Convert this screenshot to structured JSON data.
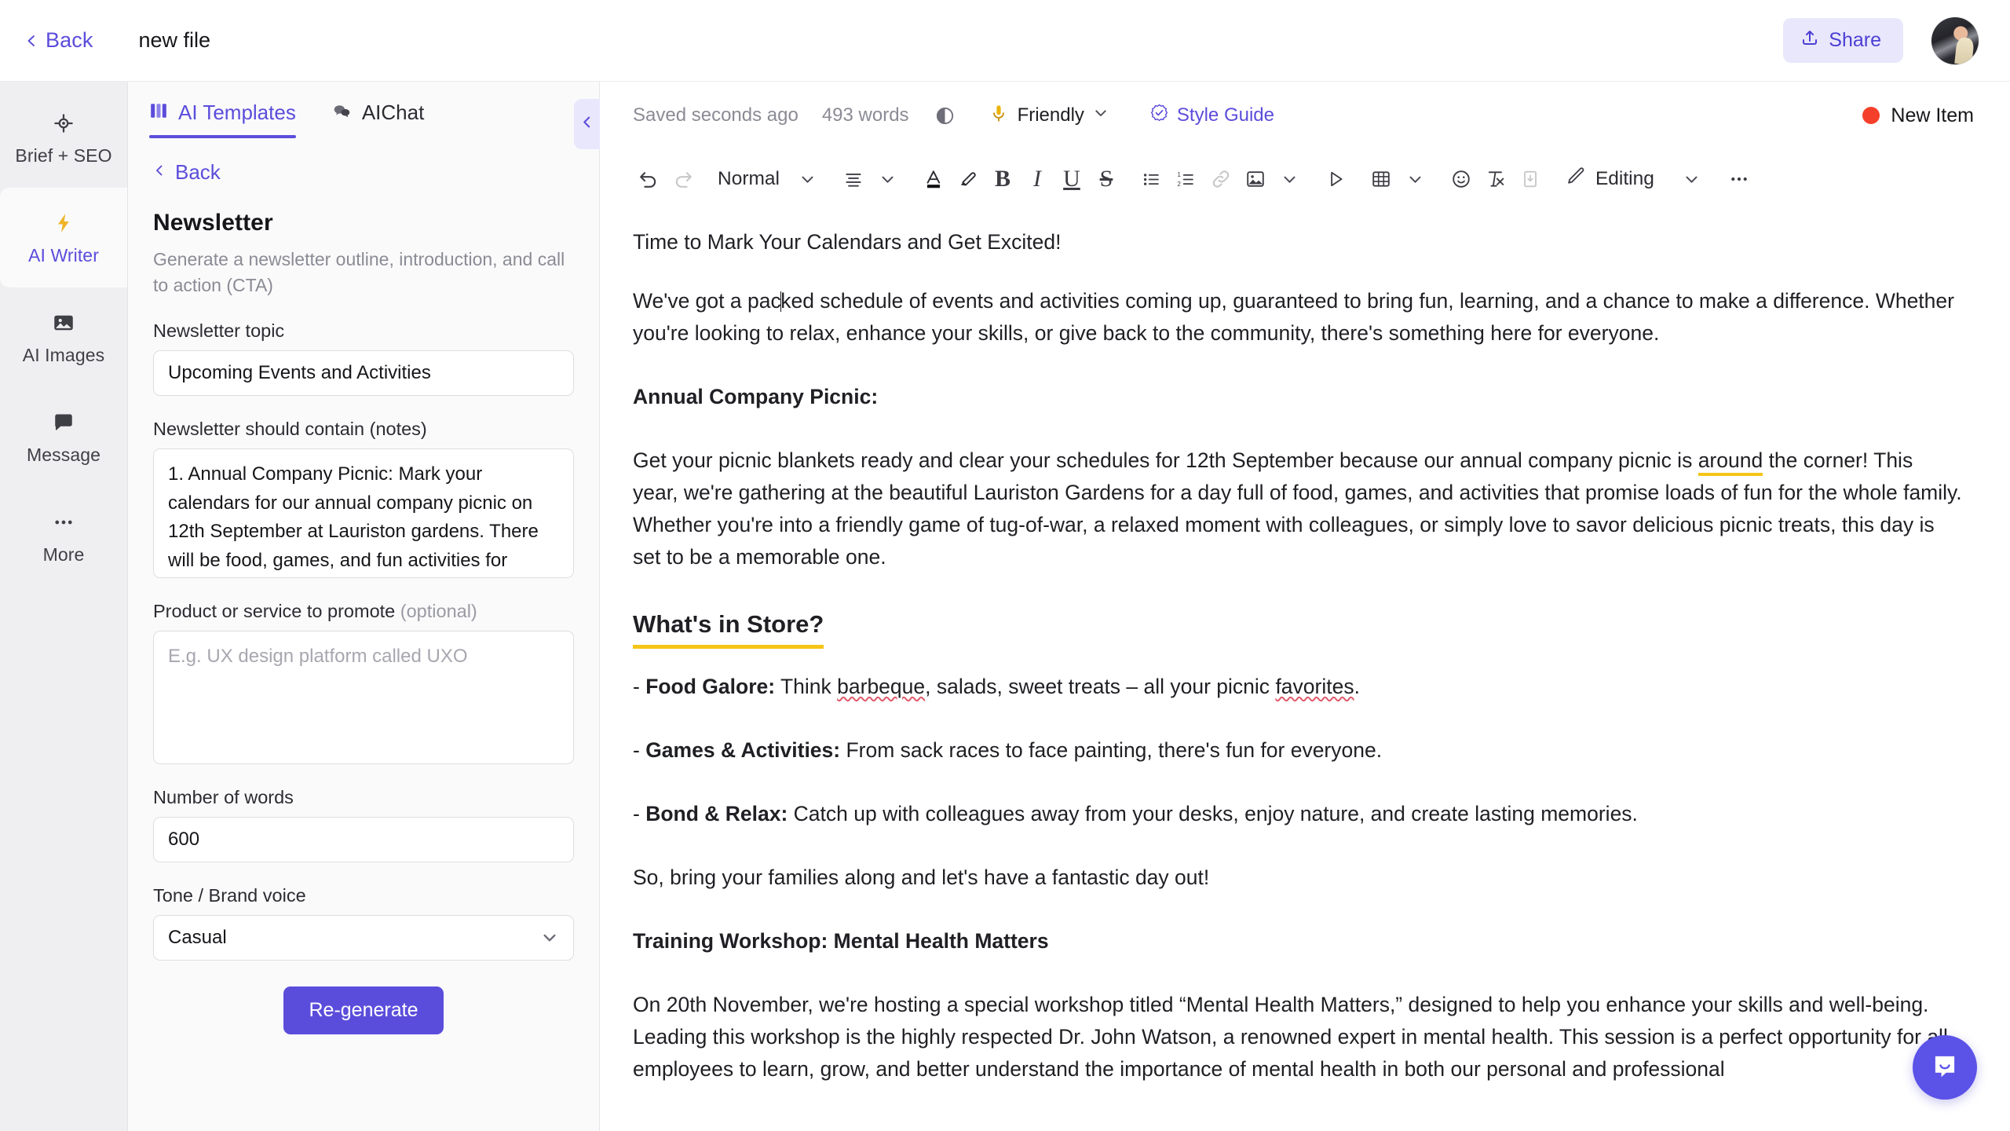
{
  "topbar": {
    "back_label": "Back",
    "file_title": "new file",
    "share_label": "Share"
  },
  "rail": {
    "items": [
      {
        "label": "Brief + SEO",
        "icon": "target-icon",
        "active": false
      },
      {
        "label": "AI Writer",
        "icon": "lightning-bolt-icon",
        "active": true
      },
      {
        "label": "AI Images",
        "icon": "image-icon",
        "active": false
      },
      {
        "label": "Message",
        "icon": "chat-bubble-icon",
        "active": false
      },
      {
        "label": "More",
        "icon": "ellipsis-icon",
        "active": false
      }
    ]
  },
  "panel": {
    "tabs": [
      {
        "label": "AI Templates",
        "icon": "templates-grid-icon",
        "active": true
      },
      {
        "label": "AIChat",
        "icon": "chat-bubbles-icon",
        "active": false
      }
    ],
    "back_label": "Back",
    "template_title": "Newsletter",
    "template_desc": "Generate a newsletter outline, introduction, and call to action (CTA)",
    "fields": {
      "topic_label": "Newsletter topic",
      "topic_value": "Upcoming Events and Activities",
      "notes_label": "Newsletter should contain (notes)",
      "notes_value": "1. Annual Company Picnic: Mark your calendars for our annual company picnic on 12th September at Lauriston gardens. There will be food, games, and fun activities for",
      "promote_label": "Product or service to promote",
      "promote_optional": "(optional)",
      "promote_value": "",
      "promote_placeholder": "E.g. UX design platform called UXO",
      "words_label": "Number of words",
      "words_value": "600",
      "tone_label": "Tone / Brand voice",
      "tone_value": "Casual"
    },
    "regenerate_label": "Re-generate"
  },
  "editor": {
    "status": {
      "saved": "Saved seconds ago",
      "words": "493 words",
      "tone": "Friendly",
      "style_guide": "Style Guide",
      "new_item": "New Item"
    },
    "toolbar": {
      "undo": "undo-icon",
      "redo": "redo-icon",
      "block_style": "Normal",
      "align": "align-icon",
      "text_color": "text-color-icon",
      "highlight": "highlighter-icon",
      "bold": "B",
      "italic": "I",
      "underline": "U",
      "strike": "S",
      "bullet_list": "bullet-list-icon",
      "numbered_list": "numbered-list-icon",
      "link": "link-icon",
      "image": "image-icon",
      "media": "play-icon",
      "table": "table-icon",
      "emoji": "emoji-icon",
      "clear_format": "clear-format-icon",
      "page_break": "page-break-icon",
      "mode_label": "Editing",
      "more": "ellipsis-icon"
    },
    "document": {
      "line_1": "Time to Mark Your Calendars and Get Excited!",
      "para_1_a": "We've got a pac",
      "para_1_b": "ked schedule of events and activities coming up, guaranteed to bring fun, learning, and a chance to make a difference. Whether you're looking to relax, enhance your skills, or give back to the community, there's something here for everyone.",
      "heading_picnic": "Annual Company Picnic:",
      "para_2_a": "Get your picnic blankets ready and clear your schedules for 12th September because our annual company picnic is ",
      "para_2_hl": "around",
      "para_2_b": " the corner! This year, we're gathering at the beautiful Lauriston Gardens for a day full of food, games, and activities that promise loads of fun for the whole family. Whether you're into a friendly game of tug-of-war, a relaxed moment with colleagues, or simply love to savor delicious picnic treats, this day is set to be a memorable one.",
      "heading_store": "What's in Store?",
      "bullets": [
        {
          "dash": "- ",
          "bold": "Food Galore:",
          "rest_a": " Think ",
          "misspelled_1": "barbeque",
          "rest_b": ", salads, sweet treats – all your picnic ",
          "misspelled_2": "favorites",
          "rest_c": "."
        },
        {
          "dash": "- ",
          "bold": "Games & Activities:",
          "rest_a": " From sack races to face painting, there's fun for everyone.",
          "misspelled_1": "",
          "rest_b": "",
          "misspelled_2": "",
          "rest_c": ""
        },
        {
          "dash": "- ",
          "bold": "Bond & Relax:",
          "rest_a": " Catch up with colleagues away from your desks, enjoy nature, and create lasting memories.",
          "misspelled_1": "",
          "rest_b": "",
          "misspelled_2": "",
          "rest_c": ""
        }
      ],
      "para_3": "So, bring your families along and let's have a fantastic day out!",
      "heading_workshop": "Training Workshop: Mental Health Matters",
      "para_4": "On 20th November, we're hosting a special workshop titled “Mental Health Matters,” designed to help you enhance your skills and well-being. Leading this workshop is the highly respected Dr. John Watson, a renowned expert in mental health. This session is a perfect opportunity for all employees to learn, grow, and better understand the importance of mental health in both our personal and professional"
    }
  },
  "colors": {
    "accent": "#5b4ddb",
    "accent_soft": "#e9e7fb",
    "highlight": "#f5c518",
    "status_red": "#f4402a",
    "intercom": "#5b52e8",
    "spellcheck": "#e05a6b"
  }
}
